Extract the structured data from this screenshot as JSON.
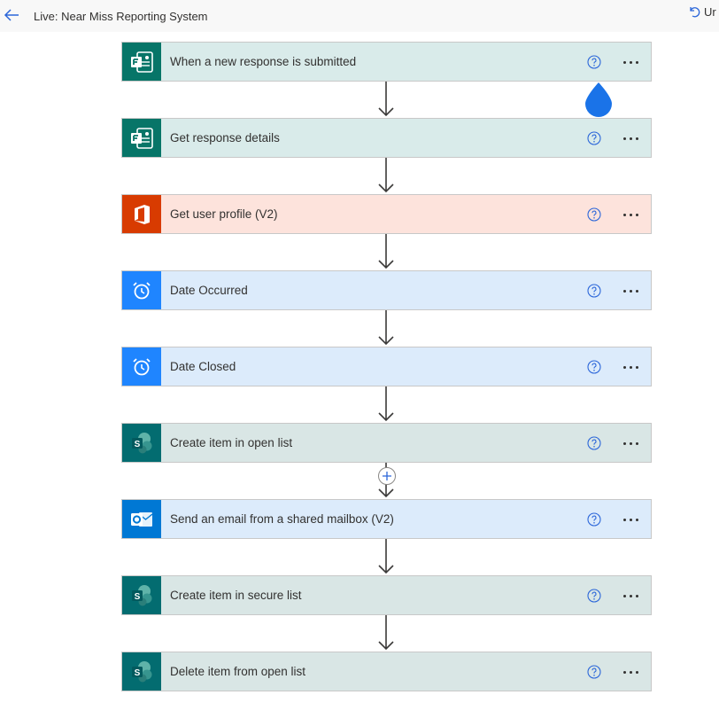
{
  "header": {
    "title": "Live: Near Miss Reporting System",
    "undo_label": "Ur"
  },
  "steps": [
    {
      "label": "When a new response is submitted",
      "icon": "forms-icon",
      "theme": "forms"
    },
    {
      "label": "Get response details",
      "icon": "forms-icon",
      "theme": "forms"
    },
    {
      "label": "Get user profile (V2)",
      "icon": "office-icon",
      "theme": "office"
    },
    {
      "label": "Date Occurred",
      "icon": "alarm-clock-icon",
      "theme": "schedule"
    },
    {
      "label": "Date Closed",
      "icon": "alarm-clock-icon",
      "theme": "schedule"
    },
    {
      "label": "Create item in open list",
      "icon": "sharepoint-icon",
      "theme": "sharepoint"
    },
    {
      "label": "Send an email from a shared mailbox (V2)",
      "icon": "outlook-icon",
      "theme": "outlook"
    },
    {
      "label": "Create item in secure list",
      "icon": "sharepoint-icon",
      "theme": "sharepoint"
    },
    {
      "label": "Delete item from open list",
      "icon": "sharepoint-icon",
      "theme": "sharepoint"
    }
  ],
  "themes": {
    "forms": {
      "icon_bg": "#077568",
      "card_bg": "#d9ebea"
    },
    "office": {
      "icon_bg": "#d83b01",
      "card_bg": "#fde3dc"
    },
    "schedule": {
      "icon_bg": "#1f85ff",
      "card_bg": "#dcebfb"
    },
    "sharepoint": {
      "icon_bg": "#036c70",
      "card_bg": "#d9e6e5"
    },
    "outlook": {
      "icon_bg": "#0078d4",
      "card_bg": "#dcebfb"
    }
  },
  "colors": {
    "accent": "#2b66d9",
    "drop_marker": "#1a73e8"
  }
}
